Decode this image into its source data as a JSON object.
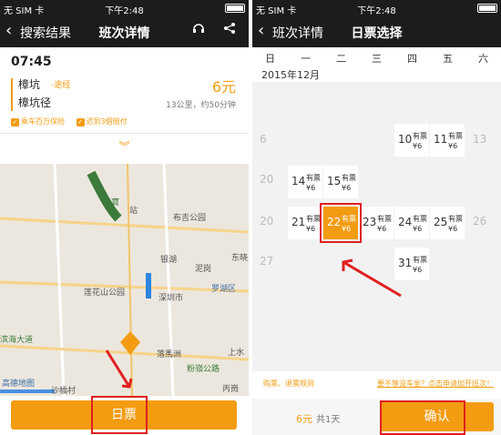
{
  "left": {
    "status": {
      "carrier": "无 SIM 卡",
      "time": "下午2:48"
    },
    "nav": {
      "back_label": "搜索结果",
      "title": "班次详情",
      "icons": [
        "headset-icon",
        "share-icon"
      ]
    },
    "trip": {
      "depart_time": "07:45",
      "start_stop": "樟坑",
      "via": "-途经",
      "end_stop": "樟坑径",
      "price": "6元",
      "distance": "13公里，约50分钟",
      "badges": [
        "乘车百万保险",
        "迟到3個賠付"
      ]
    },
    "map_labels": [
      "布吉公园",
      "银湖",
      "泥岗",
      "东晓",
      "莲花山公园",
      "深圳市",
      "罗湖区",
      "滨海大道",
      "落馬洲",
      "上水",
      "粉嶺公路",
      "沙橋村",
      "丙崗",
      "高德地图",
      "站",
      "寶"
    ],
    "primary_button": "日票"
  },
  "right": {
    "status": {
      "carrier": "无 SIM 卡",
      "time": "下午2:48"
    },
    "nav": {
      "back_label": "班次详情",
      "title": "日票选择"
    },
    "weekdays": [
      "日",
      "一",
      "二",
      "三",
      "四",
      "五",
      "六"
    ],
    "month": "2015年12月",
    "gray_days": [
      "6",
      "13",
      "20",
      "26",
      "27"
    ],
    "days": [
      {
        "day": "10",
        "tag": "有票",
        "price": "¥6"
      },
      {
        "day": "11",
        "tag": "有票",
        "price": "¥6"
      },
      {
        "day": "14",
        "tag": "有票",
        "price": "¥6"
      },
      {
        "day": "15",
        "tag": "有票",
        "price": "¥6"
      },
      {
        "day": "21",
        "tag": "有票",
        "price": "¥6"
      },
      {
        "day": "22",
        "tag": "有票",
        "price": "¥6"
      },
      {
        "day": "23",
        "tag": "有票",
        "price": "¥6"
      },
      {
        "day": "24",
        "tag": "有票",
        "price": "¥6"
      },
      {
        "day": "25",
        "tag": "有票",
        "price": "¥6"
      },
      {
        "day": "31",
        "tag": "有票",
        "price": "¥6"
      }
    ],
    "selected_day": "22",
    "footer": {
      "rules": "购票、退票规则",
      "no_bus": "要不够没车坐？点击申请加开班次！"
    },
    "total": {
      "price": "6元",
      "days": "共1天"
    },
    "confirm_button": "确认"
  }
}
